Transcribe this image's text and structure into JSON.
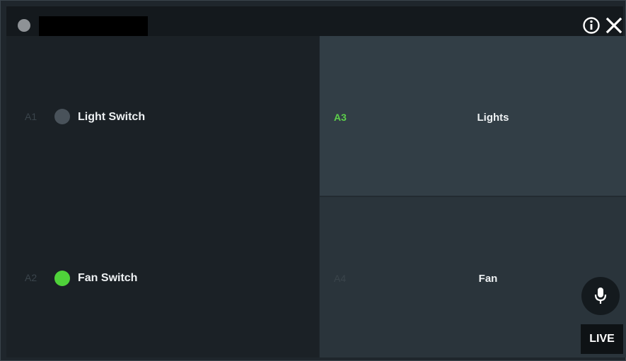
{
  "titlebar": {
    "title": "",
    "info_icon": "info-circle-icon",
    "close_icon": "close-icon"
  },
  "tiles": [
    {
      "id": "A1",
      "label": "Light Switch",
      "state": "off",
      "dot_color": "#49525a"
    },
    {
      "id": "A2",
      "label": "Fan Switch",
      "state": "on",
      "dot_color": "#4fd23a"
    },
    {
      "id": "A3",
      "label": "Lights",
      "active": true
    },
    {
      "id": "A4",
      "label": "Fan",
      "active": false
    }
  ],
  "colors": {
    "accent_green": "#5ccf4a",
    "tile_dark": "#1b2126",
    "tile_selected": "#323e46",
    "tile_secondary": "#2a343b"
  },
  "controls": {
    "mic_icon": "microphone-icon",
    "live_label": "LIVE"
  }
}
